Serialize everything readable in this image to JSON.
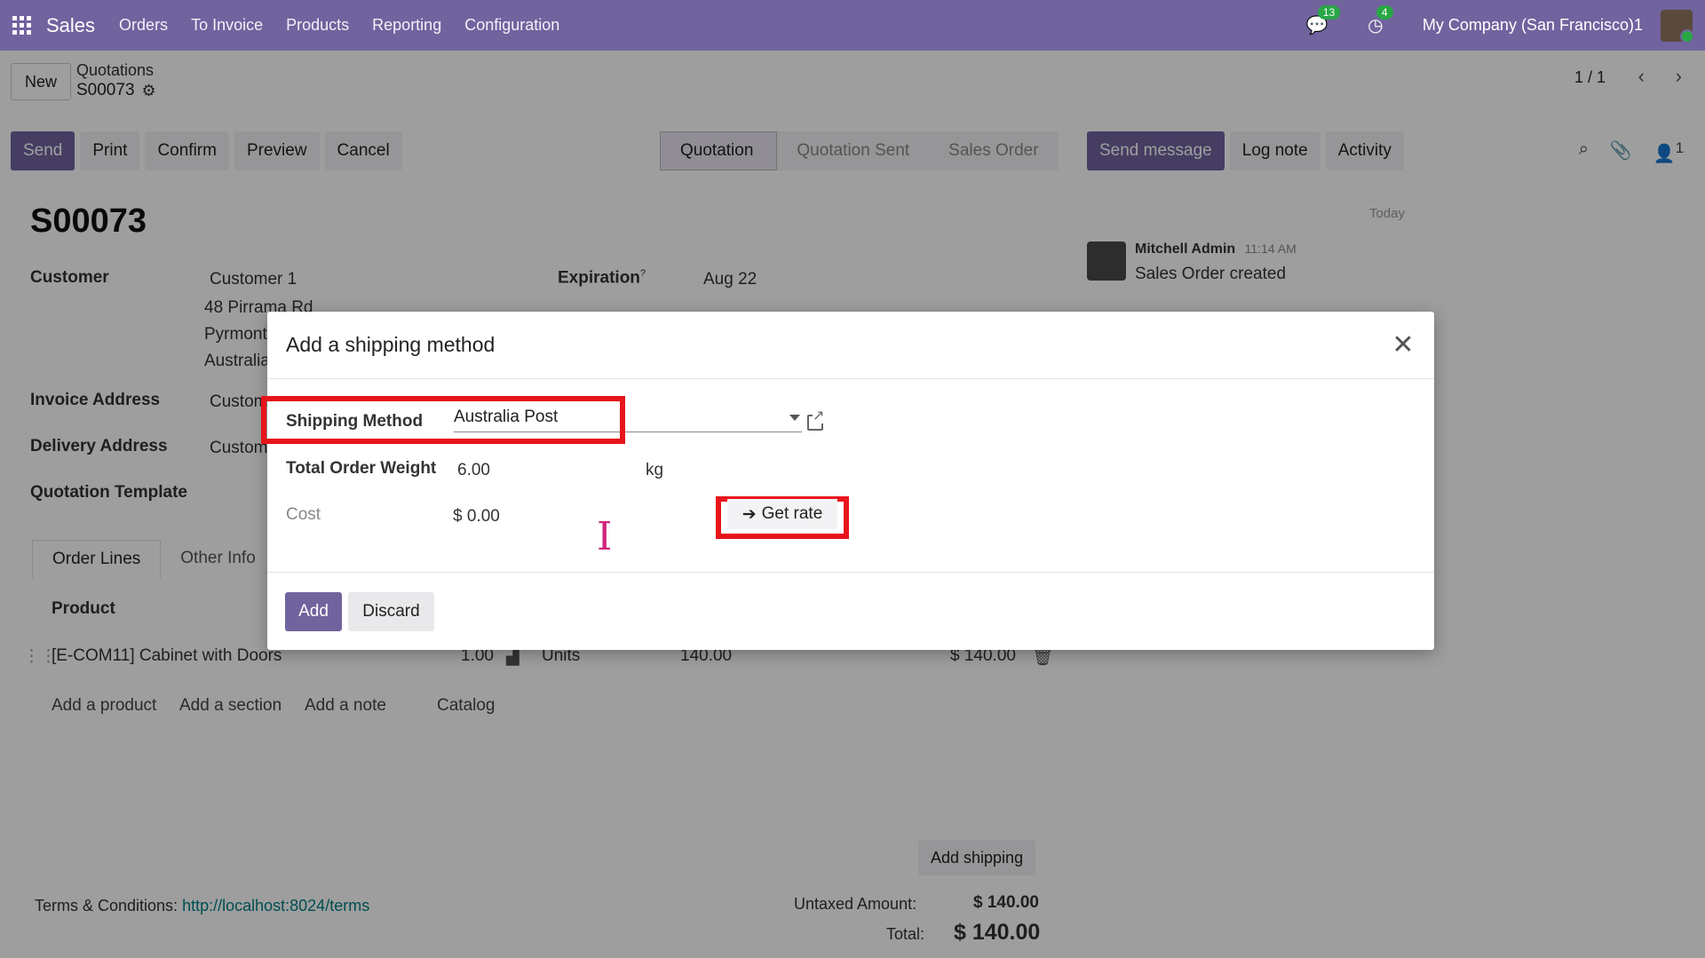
{
  "navbar": {
    "brand": "Sales",
    "menu": [
      "Orders",
      "To Invoice",
      "Products",
      "Reporting",
      "Configuration"
    ],
    "messages_badge": "13",
    "activities_badge": "4",
    "company": "My Company (San Francisco)1"
  },
  "control_panel": {
    "new_label": "New",
    "breadcrumb_parent": "Quotations",
    "breadcrumb_current": "S00073",
    "pager": "1 / 1",
    "actions": [
      "Send",
      "Print",
      "Confirm",
      "Preview",
      "Cancel"
    ],
    "statuses": [
      "Quotation",
      "Quotation Sent",
      "Sales Order"
    ],
    "active_status": "Quotation",
    "chatter_buttons": [
      "Send message",
      "Log note",
      "Activity"
    ],
    "followers_count": "1"
  },
  "form": {
    "title": "S00073",
    "customer_label": "Customer",
    "customer_name": "Customer 1",
    "customer_address_1": "48 Pirrama Rd",
    "customer_address_2": "Pyrmont",
    "customer_address_3": "Australia",
    "expiration_label": "Expiration",
    "expiration_help": "?",
    "expiration_value": "Aug 22",
    "invoice_address_label": "Invoice Address",
    "invoice_address_value": "Custom",
    "delivery_address_label": "Delivery Address",
    "delivery_address_value": "Custom",
    "quotation_template_label": "Quotation Template",
    "tabs": [
      "Order Lines",
      "Other Info"
    ],
    "product_header": "Product",
    "line": {
      "product": "[E-COM11] Cabinet with Doors",
      "quantity": "1.00",
      "uom": "Units",
      "price": "140.00",
      "subtotal": "$ 140.00"
    },
    "line_actions": [
      "Add a product",
      "Add a section",
      "Add a note",
      "Catalog"
    ],
    "add_shipping_label": "Add shipping",
    "terms_label": "Terms & Conditions:",
    "terms_link": "http://localhost:8024/terms",
    "untaxed_label": "Untaxed Amount:",
    "untaxed_value": "$ 140.00",
    "total_label": "Total:",
    "total_value": "$ 140.00"
  },
  "chatter": {
    "date_separator": "Today",
    "author": "Mitchell Admin",
    "time": "11:14 AM",
    "message": "Sales Order created"
  },
  "dialog": {
    "title": "Add a shipping method",
    "shipping_method_label": "Shipping Method",
    "shipping_method_value": "Australia Post",
    "weight_label": "Total Order Weight",
    "weight_value": "6.00",
    "weight_unit": "kg",
    "cost_label": "Cost",
    "cost_value": "$ 0.00",
    "get_rate_label": "Get rate",
    "add_label": "Add",
    "discard_label": "Discard"
  },
  "colors": {
    "brand": "#71639e",
    "highlight": "#e8141c",
    "link": "#017e84"
  }
}
